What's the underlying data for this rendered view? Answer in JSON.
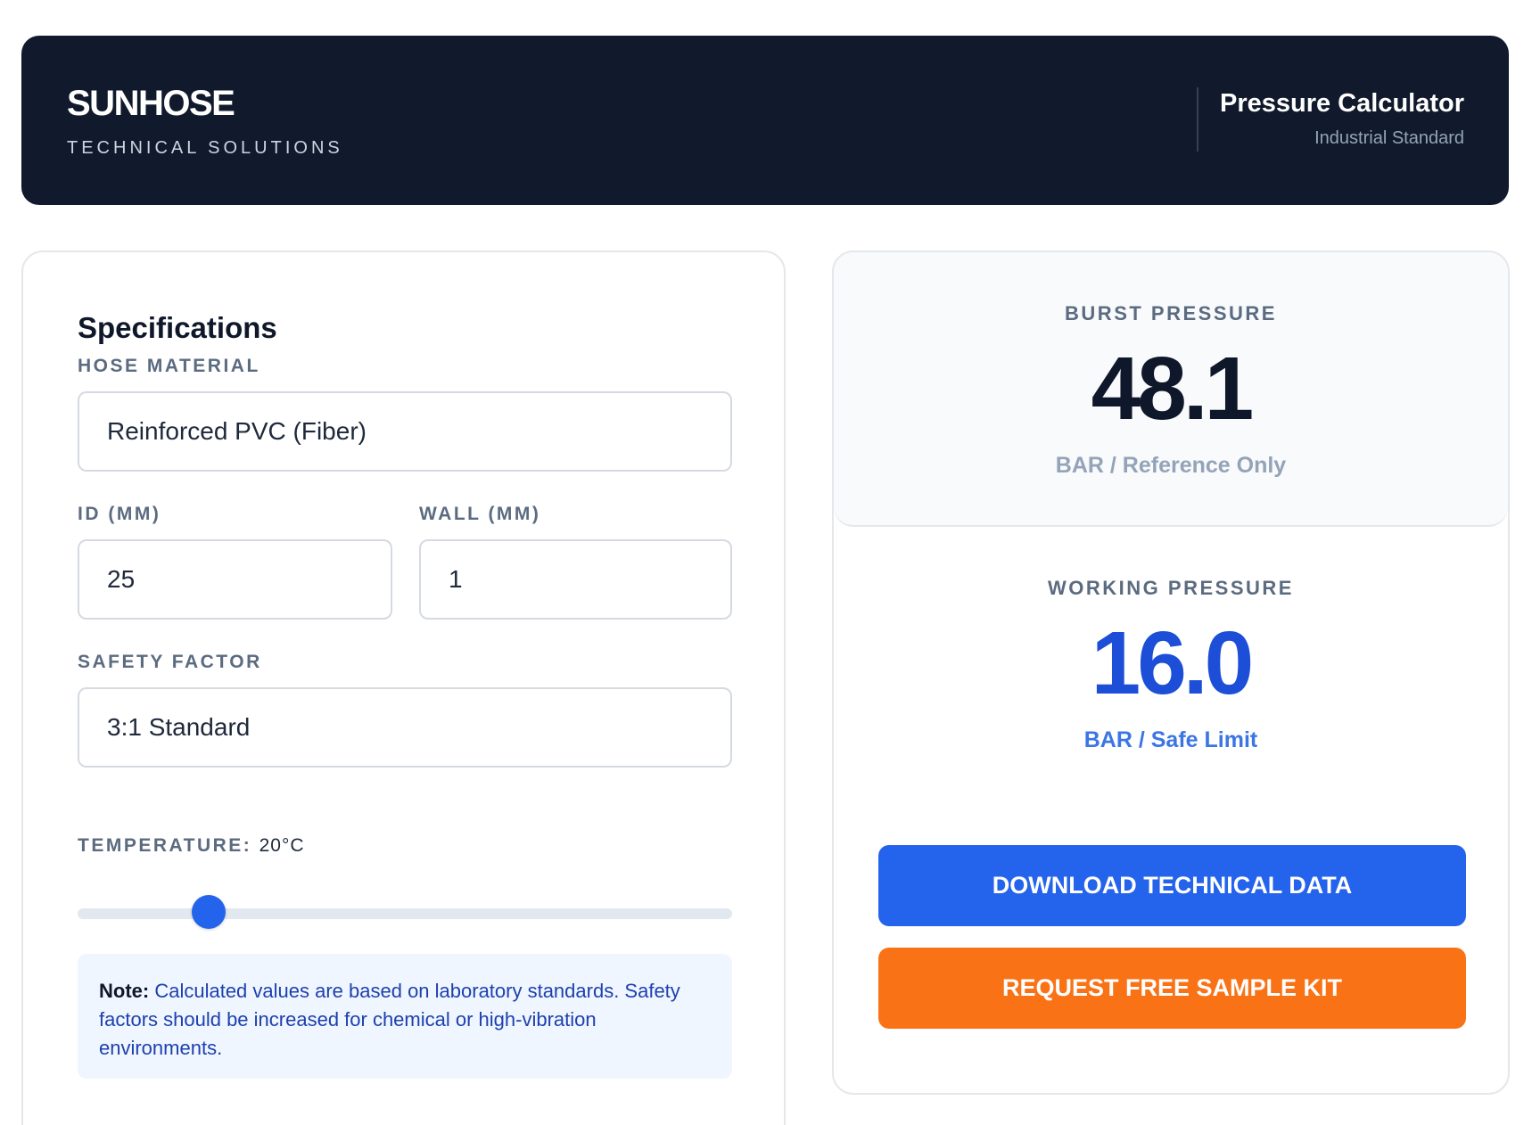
{
  "header": {
    "brand_name": "SUNHOSE",
    "brand_tagline": "TECHNICAL SOLUTIONS",
    "title": "Pressure Calculator",
    "subtitle": "Industrial Standard"
  },
  "specifications": {
    "title": "Specifications",
    "hose_material": {
      "label": "HOSE MATERIAL",
      "value": "Reinforced PVC (Fiber)"
    },
    "id_mm": {
      "label": "ID (MM)",
      "value": "25"
    },
    "wall_mm": {
      "label": "WALL (MM)",
      "value": "1"
    },
    "safety_factor": {
      "label": "SAFETY FACTOR",
      "value": "3:1 Standard"
    },
    "temperature": {
      "label": "TEMPERATURE:",
      "value": "20°C",
      "slider_fraction": 0.2
    },
    "note": {
      "bold": "Note:",
      "text": " Calculated values are based on laboratory standards. Safety factors should be increased for chemical or high-vibration environments."
    }
  },
  "results": {
    "burst": {
      "label": "BURST PRESSURE",
      "value": "48.1",
      "unit": "BAR / Reference Only"
    },
    "working": {
      "label": "WORKING PRESSURE",
      "value": "16.0",
      "unit": "BAR / Safe Limit"
    }
  },
  "actions": {
    "download_label": "DOWNLOAD TECHNICAL DATA",
    "request_label": "REQUEST FREE SAMPLE KIT"
  },
  "colors": {
    "header_bg": "#111a2c",
    "accent_blue": "#2463eb",
    "accent_orange": "#f97316",
    "working_value": "#1d4ed8"
  }
}
